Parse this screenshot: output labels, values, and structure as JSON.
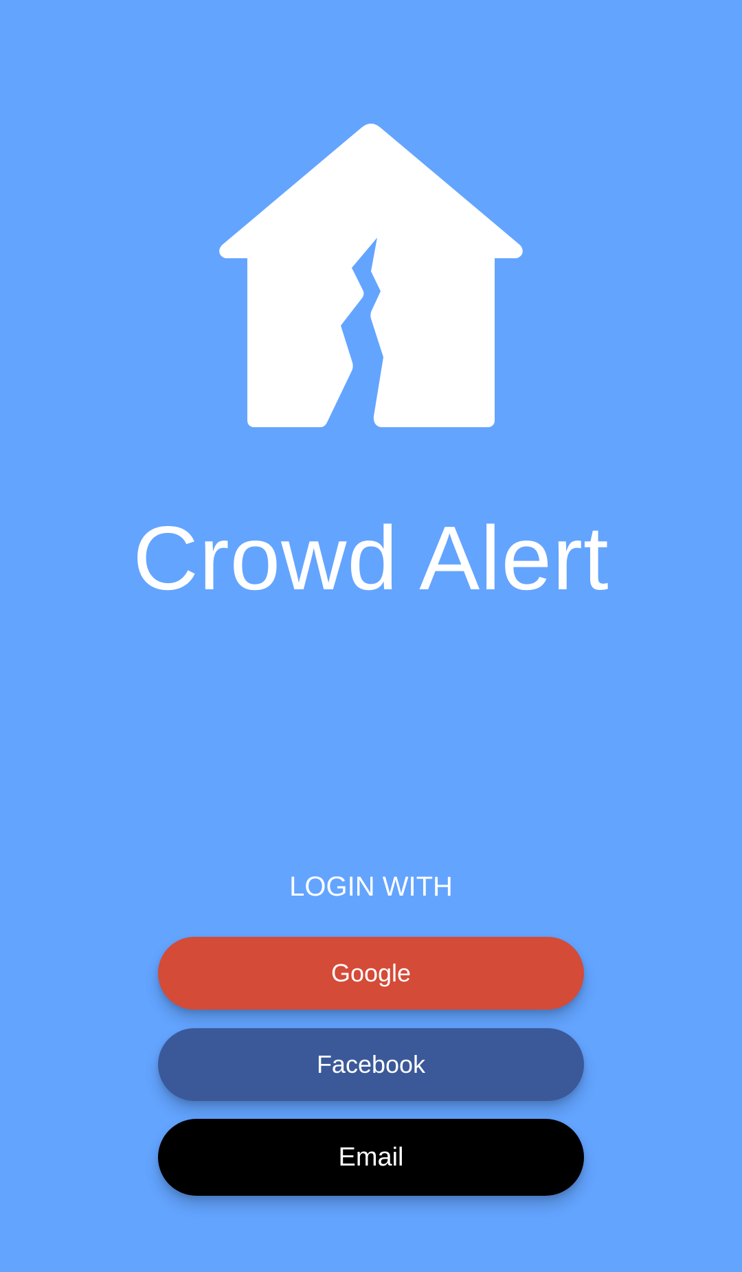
{
  "app": {
    "title": "Crowd Alert",
    "logo_icon": "cracked-house-icon"
  },
  "login": {
    "label": "LOGIN WITH",
    "buttons": {
      "google": "Google",
      "facebook": "Facebook",
      "email": "Email"
    }
  },
  "colors": {
    "background": "#63a4ff",
    "google": "#d44b38",
    "facebook": "#3b5999",
    "email": "#000000",
    "text": "#ffffff"
  }
}
